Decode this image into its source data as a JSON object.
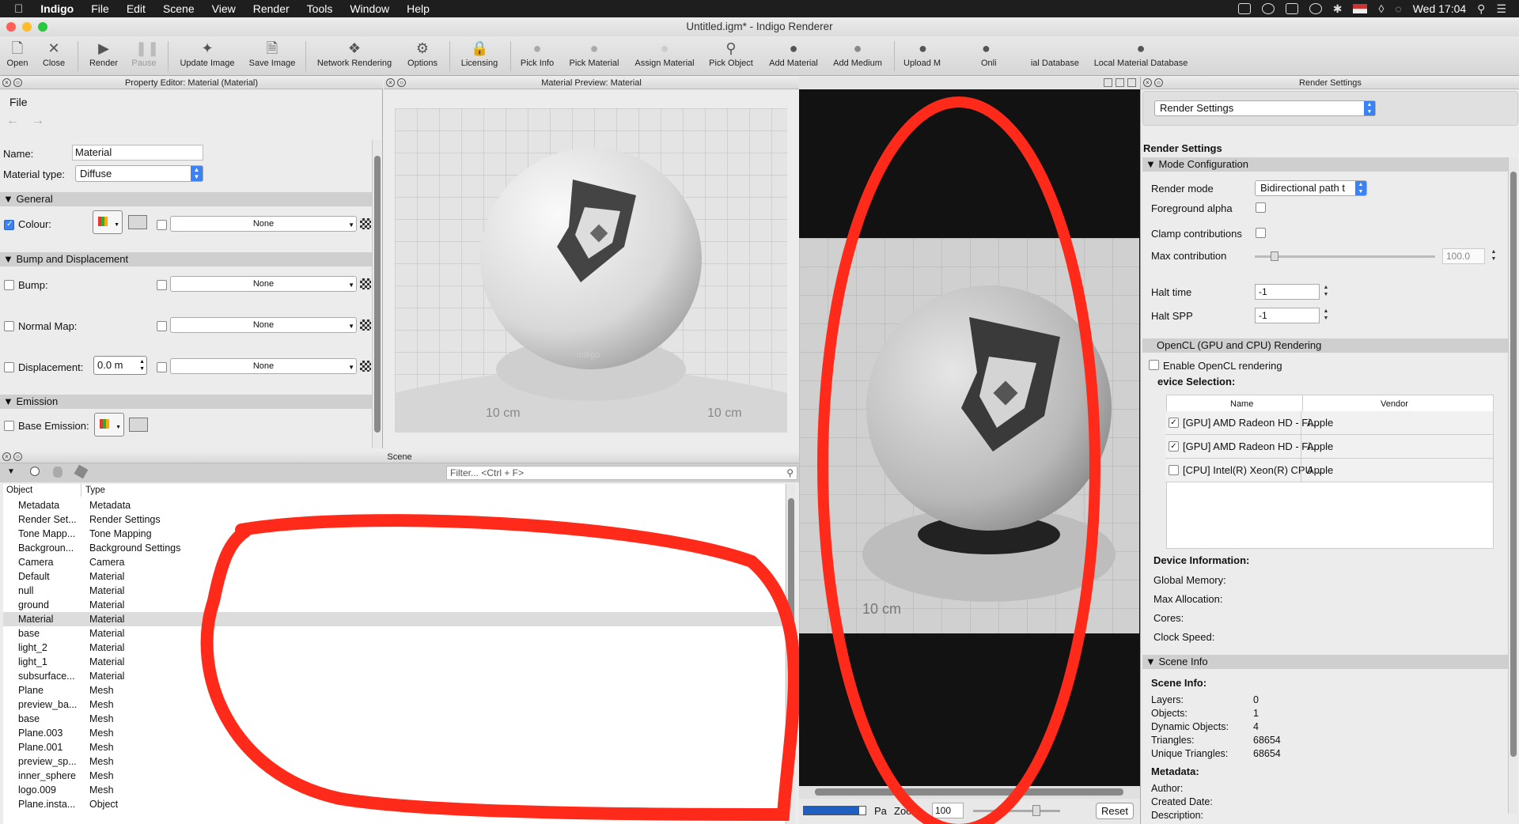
{
  "menubar": {
    "app": "Indigo",
    "items": [
      "File",
      "Edit",
      "Scene",
      "View",
      "Render",
      "Tools",
      "Window",
      "Help"
    ],
    "clock": "Wed 17:04"
  },
  "window": {
    "title": "Untitled.igm* - Indigo Renderer"
  },
  "toolbar": {
    "open": "Open",
    "close": "Close",
    "render": "Render",
    "pause": "Pause",
    "update_image": "Update Image",
    "save_image": "Save Image",
    "network_rendering": "Network Rendering",
    "options": "Options",
    "licensing": "Licensing",
    "pick_info": "Pick Info",
    "pick_material": "Pick Material",
    "assign_material": "Assign Material",
    "pick_object": "Pick Object",
    "add_material": "Add Material",
    "add_medium": "Add Medium",
    "upload": "Upload M",
    "online": "Onli",
    "db_fragment": "ial Database",
    "local_db": "Local Material Database"
  },
  "property_editor": {
    "title": "Property Editor: Material (Material)",
    "menu_file": "File",
    "name_label": "Name:",
    "name_value": "Material",
    "type_label": "Material type:",
    "type_value": "Diffuse",
    "general": "General",
    "colour": "Colour:",
    "none": "None",
    "bump_section": "Bump and Displacement",
    "bump": "Bump:",
    "normal_map": "Normal Map:",
    "displacement": "Displacement:",
    "displacement_value": "0.0 m",
    "emission": "Emission",
    "base_emission": "Base Emission:"
  },
  "preview": {
    "title": "Material Preview: Material",
    "grid_labels": [
      "10 cm",
      "10 cm",
      "10 cm",
      "10 cm"
    ],
    "logo": "indigo"
  },
  "scene": {
    "title": "Scene",
    "filter_placeholder": "Filter... <Ctrl + F>",
    "col_object": "Object",
    "col_type": "Type",
    "rows": [
      {
        "object": "Metadata",
        "type": "Metadata"
      },
      {
        "object": "Render Set...",
        "type": "Render Settings"
      },
      {
        "object": "Tone Mapp...",
        "type": "Tone Mapping"
      },
      {
        "object": "Backgroun...",
        "type": "Background Settings"
      },
      {
        "object": "Camera",
        "type": "Camera"
      },
      {
        "object": "Default",
        "type": "Material"
      },
      {
        "object": "null",
        "type": "Material"
      },
      {
        "object": "ground",
        "type": "Material"
      },
      {
        "object": "Material",
        "type": "Material",
        "selected": true
      },
      {
        "object": "base",
        "type": "Material"
      },
      {
        "object": "light_2",
        "type": "Material"
      },
      {
        "object": "light_1",
        "type": "Material"
      },
      {
        "object": "subsurface...",
        "type": "Material"
      },
      {
        "object": "Plane",
        "type": "Mesh"
      },
      {
        "object": "preview_ba...",
        "type": "Mesh"
      },
      {
        "object": "base",
        "type": "Mesh"
      },
      {
        "object": "Plane.003",
        "type": "Mesh"
      },
      {
        "object": "Plane.001",
        "type": "Mesh"
      },
      {
        "object": "preview_sp...",
        "type": "Mesh"
      },
      {
        "object": "inner_sphere",
        "type": "Mesh"
      },
      {
        "object": "logo.009",
        "type": "Mesh"
      },
      {
        "object": "Plane.insta...",
        "type": "Object"
      }
    ]
  },
  "render_view": {
    "grid_label": "10 cm",
    "pa": "Pa",
    "zoom_label": "Zoom:",
    "zoom_value": "100",
    "reset": "Reset"
  },
  "render_settings": {
    "title": "Render Settings",
    "dropdown": "Render Settings",
    "heading": "Render Settings",
    "mode_config": "Mode Configuration",
    "render_mode_label": "Render mode",
    "render_mode_value": "Bidirectional path t",
    "foreground_alpha": "Foreground alpha",
    "clamp": "Clamp contributions",
    "max_contrib": "Max contribution",
    "max_contrib_value": "100.0",
    "halt_time": "Halt time",
    "halt_time_value": "-1",
    "halt_spp": "Halt SPP",
    "halt_spp_value": "-1",
    "opencl": "OpenCL (GPU and CPU) Rendering",
    "enable_opencl": "Enable OpenCL rendering",
    "device_selection": "evice Selection:",
    "col_name": "Name",
    "col_vendor": "Vendor",
    "devices": [
      {
        "name": "[GPU] AMD Radeon HD - Fi...",
        "vendor": "Apple"
      },
      {
        "name": "[GPU] AMD Radeon HD - Fi...",
        "vendor": "Apple"
      },
      {
        "name": "[CPU] Intel(R) Xeon(R) CPU ...",
        "vendor": "Apple"
      }
    ],
    "device_info": "Device Information:",
    "global_memory": "Global Memory:",
    "max_allocation": "Max Allocation:",
    "cores": "Cores:",
    "clock_speed": "Clock Speed:",
    "scene_info": "Scene Info",
    "scene_info_head": "Scene Info:",
    "layers": "Layers:",
    "layers_v": "0",
    "objects": "Objects:",
    "objects_v": "1",
    "dyn_objects": "Dynamic Objects:",
    "dyn_objects_v": "4",
    "triangles": "Triangles:",
    "triangles_v": "68654",
    "unique_triangles": "Unique Triangles:",
    "unique_triangles_v": "68654",
    "metadata": "Metadata:",
    "author": "Author:",
    "created": "Created Date:",
    "description": "Description:"
  },
  "colors": {
    "annotation": "#ff2a1a",
    "accent": "#3b82f6"
  }
}
